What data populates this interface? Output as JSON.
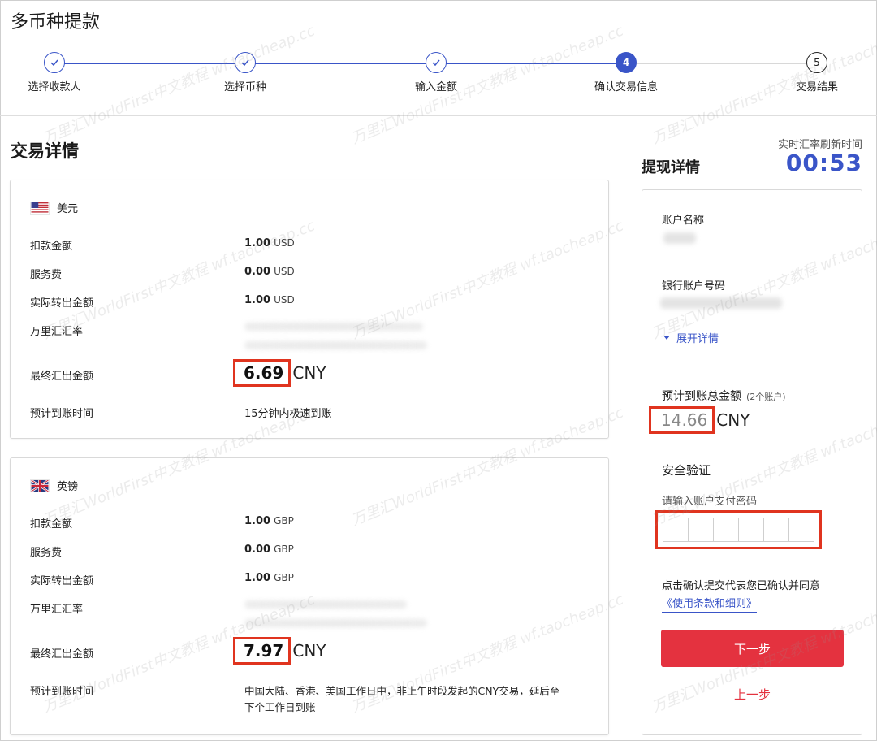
{
  "page_title": "多币种提款",
  "stepper": {
    "steps": [
      {
        "label": "选择收款人",
        "state": "done"
      },
      {
        "label": "选择币种",
        "state": "done"
      },
      {
        "label": "输入金额",
        "state": "done"
      },
      {
        "label": "确认交易信息",
        "state": "active",
        "number": "4"
      },
      {
        "label": "交易结果",
        "state": "todo",
        "number": "5"
      }
    ],
    "active_color": "#3a55c8"
  },
  "section_title": "交易详情",
  "cards": [
    {
      "currency_name": "美元",
      "flag_icon": "us-flag-icon",
      "rows": {
        "debit_label": "扣款金额",
        "debit_value": "1.00",
        "debit_unit": "USD",
        "fee_label": "服务费",
        "fee_value": "0.00",
        "fee_unit": "USD",
        "actual_label": "实际转出金额",
        "actual_value": "1.00",
        "actual_unit": "USD",
        "rate_label": "万里汇汇率",
        "final_label": "最终汇出金额",
        "final_value": "6.69",
        "final_unit": "CNY",
        "eta_label": "预计到账时间",
        "eta_value": "15分钟内极速到账"
      }
    },
    {
      "currency_name": "英镑",
      "flag_icon": "uk-flag-icon",
      "rows": {
        "debit_label": "扣款金额",
        "debit_value": "1.00",
        "debit_unit": "GBP",
        "fee_label": "服务费",
        "fee_value": "0.00",
        "fee_unit": "GBP",
        "actual_label": "实际转出金额",
        "actual_value": "1.00",
        "actual_unit": "GBP",
        "rate_label": "万里汇汇率",
        "final_label": "最终汇出金额",
        "final_value": "7.97",
        "final_unit": "CNY",
        "eta_label": "预计到账时间",
        "eta_line1": "中国大陆、香港、美国工作日中，非上午时段发起的CNY交易，延后至",
        "eta_line2": "下个工作日到账"
      }
    }
  ],
  "right": {
    "refresh_label": "实时汇率刷新时间",
    "timer": "00:53",
    "title": "提现详情",
    "account_name_label": "账户名称",
    "bank_account_label": "银行账户号码",
    "expand_label": "展开详情",
    "total_label": "预计到账总金额",
    "total_sub": "(2个账户)",
    "total_value": "14.66",
    "total_unit": "CNY",
    "security_title": "安全验证",
    "password_placeholder": "请输入账户支付密码",
    "agree_text": "点击确认提交代表您已确认并同意",
    "terms_link": "《使用条款和细则》",
    "next_button": "下一步",
    "prev_button": "上一步"
  },
  "watermark": "万里汇WorldFirst中文教程 wf.taocheap.cc",
  "colors": {
    "accent": "#3a55c8",
    "highlight": "#e0341f",
    "primary_button": "#e4323f"
  }
}
